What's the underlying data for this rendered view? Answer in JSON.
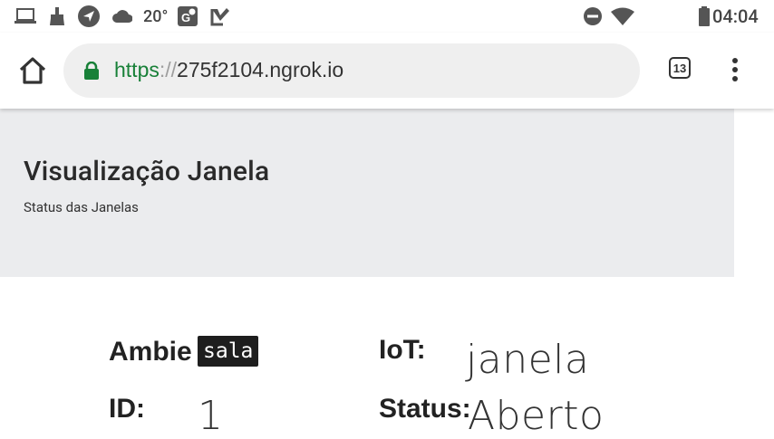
{
  "status_bar": {
    "icons": [
      "laptop-icon",
      "cleaner-icon",
      "navigation-icon",
      "cloud-icon",
      "maps-icon",
      "task-check-icon"
    ],
    "temperature": "20°",
    "right_icons": [
      "do-not-disturb-icon",
      "wifi-icon",
      "battery-icon"
    ],
    "time": "04:04"
  },
  "browser": {
    "url_scheme": "https",
    "url_separator": "://",
    "url_host": "275f2104.ngrok.io",
    "tab_count": "13",
    "secure": true,
    "colors": {
      "secure": "#188038"
    }
  },
  "header": {
    "title": "Visualização Janela",
    "subtitle": "Status das Janelas"
  },
  "fields": {
    "ambiente_label": "Ambie",
    "ambiente_value": "sala",
    "iot_label": "IoT:",
    "iot_value": "janela",
    "id_label": "ID:",
    "id_value": "1",
    "status_label": "Status:",
    "status_value": "Aberto"
  }
}
